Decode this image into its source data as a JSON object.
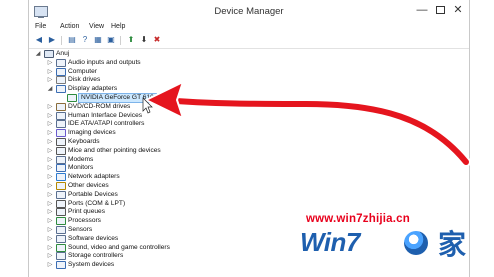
{
  "window": {
    "title": "Device Manager",
    "controls": {
      "minimize": "—",
      "maximize": "",
      "close": "✕"
    }
  },
  "menu": [
    "File",
    "Action",
    "View",
    "Help"
  ],
  "toolbar": {
    "icons": [
      "back-icon",
      "forward-icon",
      "properties-icon",
      "help-icon",
      "view-icon",
      "scan-icon",
      "update-driver-icon",
      "disable-icon",
      "uninstall-icon"
    ]
  },
  "tree": {
    "root": "Anuj",
    "categories": [
      "Audio inputs and outputs",
      "Computer",
      "Disk drives",
      "Display adapters",
      "NVIDIA GeForce GT 610",
      "DVD/CD-ROM drives",
      "Human Interface Devices",
      "IDE ATA/ATAPI controllers",
      "Imaging devices",
      "Keyboards",
      "Mice and other pointing devices",
      "Modems",
      "Monitors",
      "Network adapters",
      "Other devices",
      "Portable Devices",
      "Ports (COM & LPT)",
      "Print queues",
      "Processors",
      "Sensors",
      "Software devices",
      "Sound, video and game controllers",
      "Storage controllers",
      "System devices"
    ]
  },
  "watermark": {
    "url": "www.win7zhijia.cn",
    "logo": "Win7",
    "home_glyph": "家"
  },
  "colors": {
    "accent_arrow": "#e5151e",
    "selection": "#cce8ff",
    "watermark_red": "#e8001c",
    "watermark_blue": "#1e5fae"
  }
}
